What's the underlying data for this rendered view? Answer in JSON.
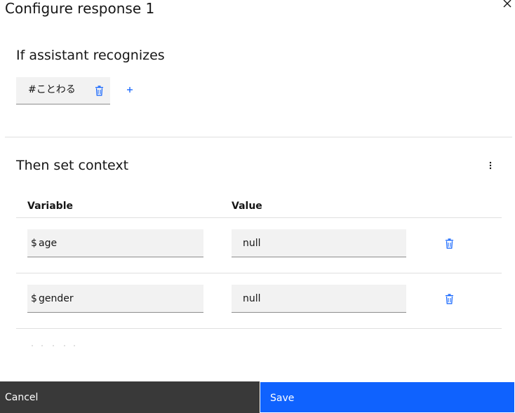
{
  "header": {
    "title": "Configure response 1"
  },
  "condition": {
    "heading": "If assistant recognizes",
    "intent": "#ことわる"
  },
  "context": {
    "heading": "Then set context",
    "columns": {
      "variable": "Variable",
      "value": "Value"
    },
    "rows": [
      {
        "prefix": "$",
        "variable": "age",
        "value": "null"
      },
      {
        "prefix": "$",
        "variable": "gender",
        "value": "null"
      }
    ]
  },
  "footer": {
    "cancel_label": "Cancel",
    "save_label": "Save"
  },
  "colors": {
    "accent": "#0f62fe",
    "cancel_bg": "#393939",
    "field_bg": "#f2f2f2"
  },
  "icons": [
    "close-icon",
    "trash-icon",
    "plus-icon",
    "overflow-menu-icon"
  ]
}
